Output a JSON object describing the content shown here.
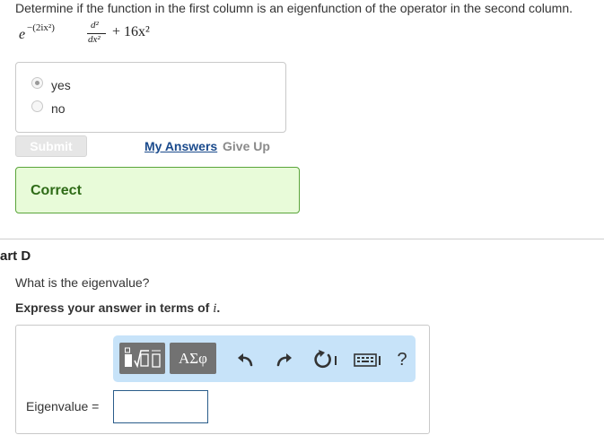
{
  "question": "Determine if the function in the first column is an eigenfunction of the operator in the second column.",
  "function": {
    "base": "e",
    "exponent": "−(2ix²)"
  },
  "operator": {
    "numerator": "d²",
    "denominator": "dx²",
    "tail": "+ 16x²"
  },
  "choices": [
    {
      "label": "yes",
      "checked": true
    },
    {
      "label": "no",
      "checked": false
    }
  ],
  "actions": {
    "submit": "Submit",
    "my_answers": "My Answers",
    "give_up": "Give Up"
  },
  "feedback": {
    "text": "Correct",
    "color": "#2e6b17"
  },
  "part": {
    "title": "art D",
    "question": "What is the eigenvalue?",
    "instruction_prefix": "Express your answer in terms of ",
    "instruction_var": "i",
    "instruction_suffix": "."
  },
  "toolbar": {
    "templates_icon": "templates-icon",
    "symbols_label": "ΑΣφ",
    "undo_icon": "undo-icon",
    "redo_icon": "redo-icon",
    "reset_icon": "reset-icon",
    "keyboard_icon": "keyboard-icon",
    "help_label": "?"
  },
  "answer": {
    "label": "Eigenvalue =",
    "value": ""
  }
}
